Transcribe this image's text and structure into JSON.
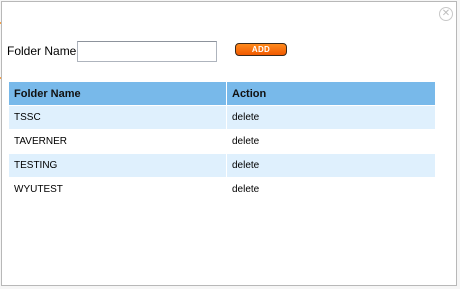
{
  "dialog": {
    "close_symbol": "✕"
  },
  "form": {
    "label": "Folder Name",
    "input_value": "",
    "input_placeholder": "",
    "add_label": "ADD"
  },
  "table": {
    "headers": [
      "Folder Name",
      "Action"
    ],
    "rows": [
      {
        "name": "TSSC",
        "action": "delete"
      },
      {
        "name": "TAVERNER",
        "action": "delete"
      },
      {
        "name": "TESTING",
        "action": "delete"
      },
      {
        "name": "WYUTEST",
        "action": "delete"
      }
    ]
  },
  "colors": {
    "header_bg": "#78b9ea",
    "alt_row_bg": "#dff0fd",
    "add_button": "#f26a05"
  }
}
